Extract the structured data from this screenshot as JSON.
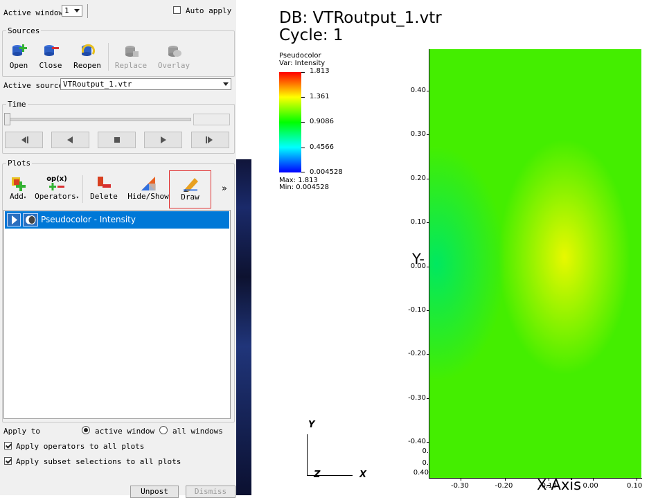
{
  "top": {
    "active_window_label": "Active window",
    "active_window_value": "1",
    "auto_apply_label": "Auto apply",
    "auto_apply_checked": false
  },
  "sources": {
    "title": "Sources",
    "buttons": [
      {
        "label": "Open",
        "enabled": true
      },
      {
        "label": "Close",
        "enabled": true
      },
      {
        "label": "Reopen",
        "enabled": true
      },
      {
        "label": "Replace",
        "enabled": false
      },
      {
        "label": "Overlay",
        "enabled": false
      }
    ],
    "active_source_label": "Active source",
    "active_source_value": "VTRoutput_1.vtr"
  },
  "time": {
    "title": "Time",
    "slider_value": 0
  },
  "plots": {
    "title": "Plots",
    "buttons": [
      {
        "label": "Add"
      },
      {
        "label": "Operators"
      },
      {
        "label": "Delete"
      },
      {
        "label": "Hide/Show"
      },
      {
        "label": "Draw"
      }
    ],
    "more_label": "»",
    "op_icon_text": "op(x)",
    "list": [
      {
        "label": "Pseudocolor - Intensity",
        "selected": true
      }
    ]
  },
  "apply": {
    "apply_to_label": "Apply to",
    "active_window_option": "active window",
    "all_windows_option": "all windows",
    "selected": "active window",
    "operators_label": "Apply operators to all plots",
    "operators_checked": true,
    "subset_label": "Apply subset selections to all plots",
    "subset_checked": true
  },
  "bottom_buttons": {
    "unpost": "Unpost",
    "dismiss": "Dismiss"
  },
  "viz": {
    "db_title": "DB: VTRoutput_1.vtr",
    "cycle": "Cycle: 1",
    "legend": {
      "title": "Pseudocolor",
      "var": "Var: Intensity",
      "ticks": [
        "1.813",
        "1.361",
        "0.9086",
        "0.4566",
        "0.004528"
      ],
      "max": "Max: 1.813",
      "min": "Min: 0.004528"
    },
    "colors": {
      "high": "#ff0000",
      "mid_high": "#ffff00",
      "mid": "#00ff00",
      "mid_low": "#00ffff",
      "low": "#0000ff",
      "selection": "#0078d7",
      "highlight_box": "#e03030"
    },
    "y_ticks": [
      "0.40",
      "0.30",
      "0.20",
      "0.10",
      "0.00",
      "-0.10",
      "-0.20",
      "-0.30",
      "-0.40"
    ],
    "x_ticks": [
      "-0.30",
      "-0.20",
      "-0.10",
      "0.00",
      "0.10"
    ],
    "y_ticks_partial": [
      "0.",
      "0.",
      "0.40"
    ],
    "y_axis_label": "Y-",
    "x_axis_label": "X-Axis",
    "triad": {
      "y": "Y",
      "z": "Z",
      "x": "X"
    }
  }
}
